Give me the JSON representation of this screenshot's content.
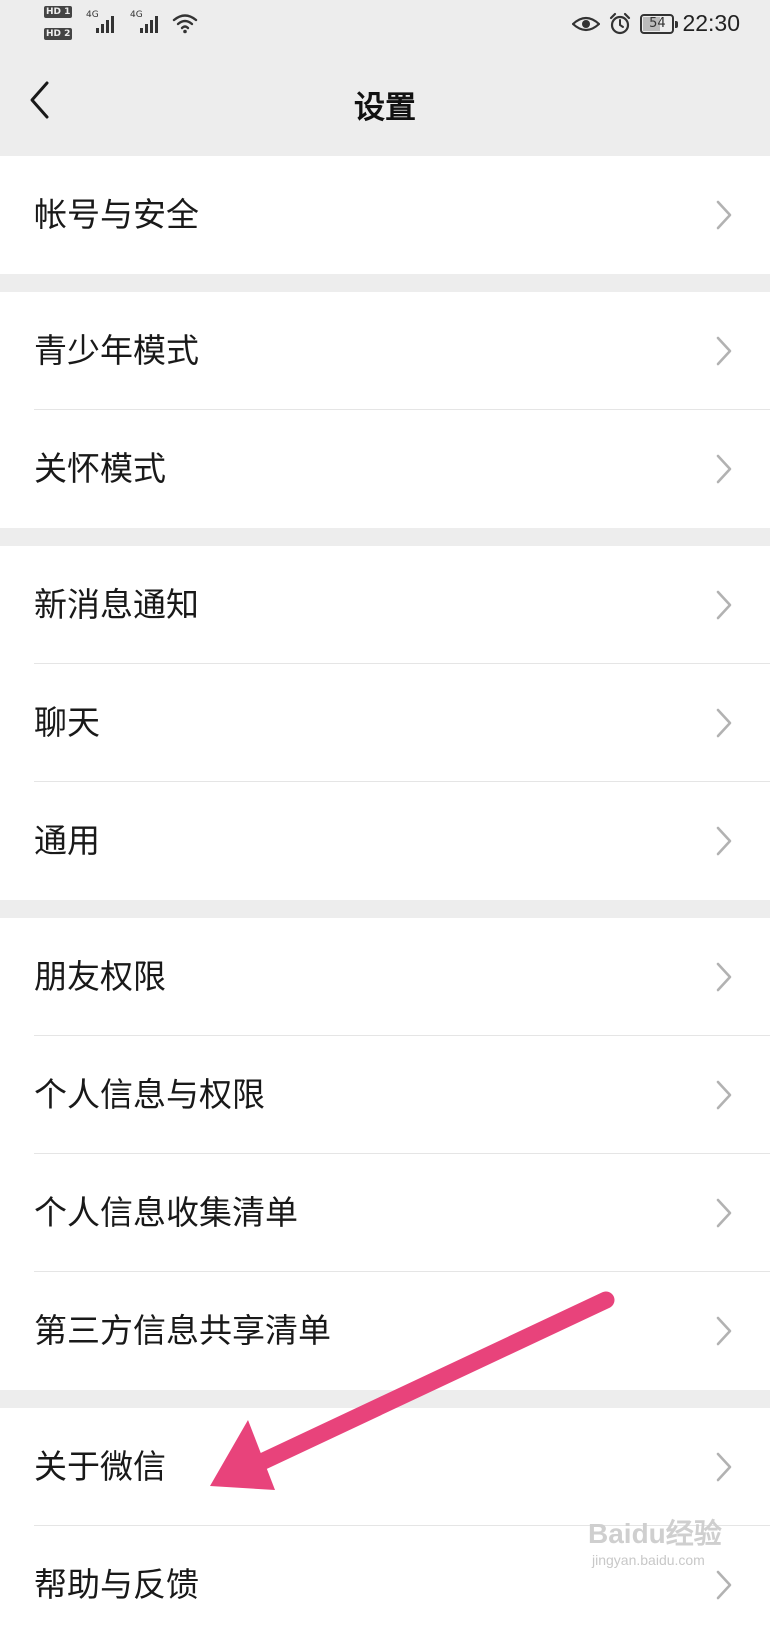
{
  "status_bar": {
    "sim1": "HD 1",
    "sim2": "HD 2",
    "network1": "4G",
    "network2": "4G",
    "battery": "54",
    "time": "22:30",
    "icons": [
      "wifi-icon",
      "eye-icon",
      "alarm-icon",
      "battery-icon"
    ]
  },
  "nav": {
    "title": "设置",
    "back_icon": "chevron-left-icon"
  },
  "groups": [
    {
      "items": [
        "帐号与安全"
      ]
    },
    {
      "items": [
        "青少年模式",
        "关怀模式"
      ]
    },
    {
      "items": [
        "新消息通知",
        "聊天",
        "通用"
      ]
    },
    {
      "items": [
        "朋友权限",
        "个人信息与权限",
        "个人信息收集清单",
        "第三方信息共享清单"
      ]
    },
    {
      "items": [
        "关于微信",
        "帮助与反馈"
      ]
    }
  ],
  "annotation": {
    "arrow_color": "#e8437b"
  },
  "watermark": {
    "brand": "Baidu经验",
    "url": "jingyan.baidu.com"
  },
  "colors": {
    "background": "#ededed",
    "item_background": "#ffffff",
    "text": "#191919",
    "chevron": "#b2b2b2"
  }
}
